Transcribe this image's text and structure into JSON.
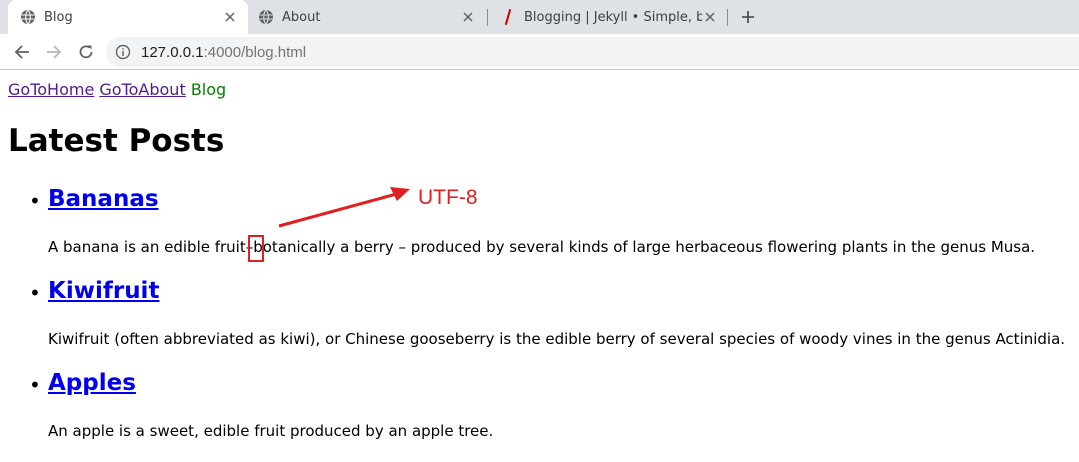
{
  "browser": {
    "tabs": [
      {
        "title": "Blog",
        "active": true,
        "icon": "globe-icon"
      },
      {
        "title": "About",
        "active": false,
        "icon": "globe-icon"
      },
      {
        "title": "Blogging | Jekyll • Simple, blog",
        "active": false,
        "icon": "jekyll-icon"
      }
    ],
    "url": {
      "host": "127.0.0.1",
      "rest": ":4000/blog.html"
    }
  },
  "page": {
    "nav": [
      {
        "label": "GoToHome",
        "state": "visited"
      },
      {
        "label": "GoToAbout",
        "state": "visited"
      },
      {
        "label": "Blog",
        "state": "current"
      }
    ],
    "heading": "Latest Posts",
    "posts": [
      {
        "title": "Bananas",
        "excerpt_before": "A banana is an edible fruit",
        "excerpt_dash": "–",
        "excerpt_after": "botanically a berry – produced by several kinds of large herbaceous flowering plants in the genus Musa."
      },
      {
        "title": "Kiwifruit",
        "excerpt": "Kiwifruit (often abbreviated as kiwi), or Chinese gooseberry is the edible berry of several species of woody vines in the genus Actinidia."
      },
      {
        "title": "Apples",
        "excerpt": "An apple is a sweet, edible fruit produced by an apple tree."
      }
    ]
  },
  "annotation": {
    "label": "UTF-8"
  },
  "colors": {
    "annotation": "#e02020",
    "link": "#0000ee",
    "visited": "#551a8b",
    "current": "#008000"
  }
}
